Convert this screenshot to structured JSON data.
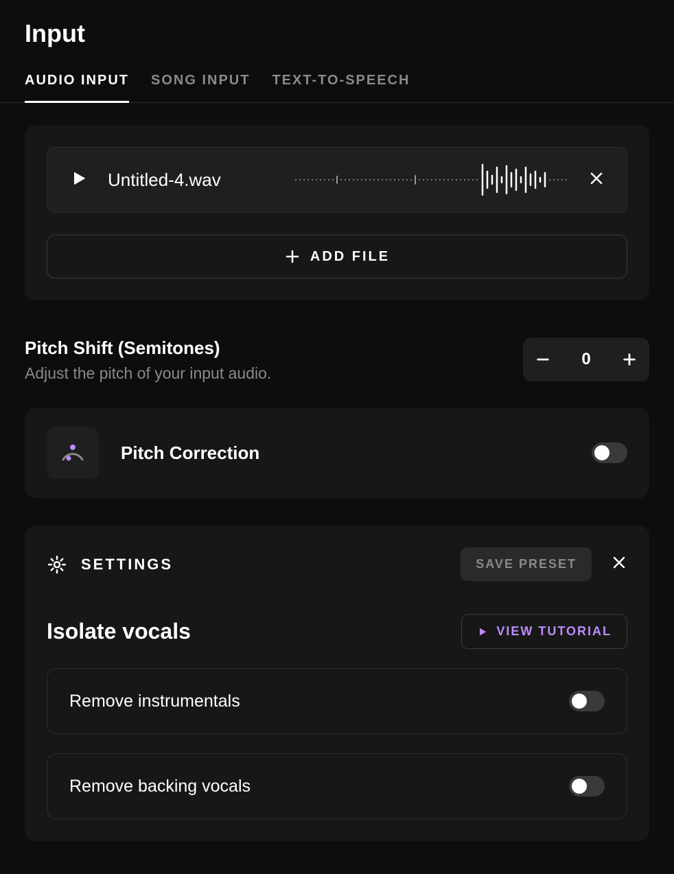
{
  "pageTitle": "Input",
  "tabs": [
    "AUDIO INPUT",
    "SONG INPUT",
    "TEXT-TO-SPEECH"
  ],
  "activeTab": 0,
  "file": {
    "name": "Untitled-4.wav"
  },
  "addFile": {
    "label": "ADD FILE"
  },
  "pitchShift": {
    "label": "Pitch Shift (Semitones)",
    "description": "Adjust the pitch of your input audio.",
    "value": "0"
  },
  "pitchCorrection": {
    "label": "Pitch Correction",
    "enabled": false
  },
  "settings": {
    "title": "SETTINGS",
    "savePreset": "SAVE PRESET",
    "isolate": {
      "title": "Isolate vocals",
      "tutorial": "VIEW TUTORIAL",
      "options": [
        {
          "label": "Remove instrumentals",
          "enabled": false
        },
        {
          "label": "Remove backing vocals",
          "enabled": false
        }
      ]
    }
  },
  "colors": {
    "accent": "#BC8CFF"
  }
}
